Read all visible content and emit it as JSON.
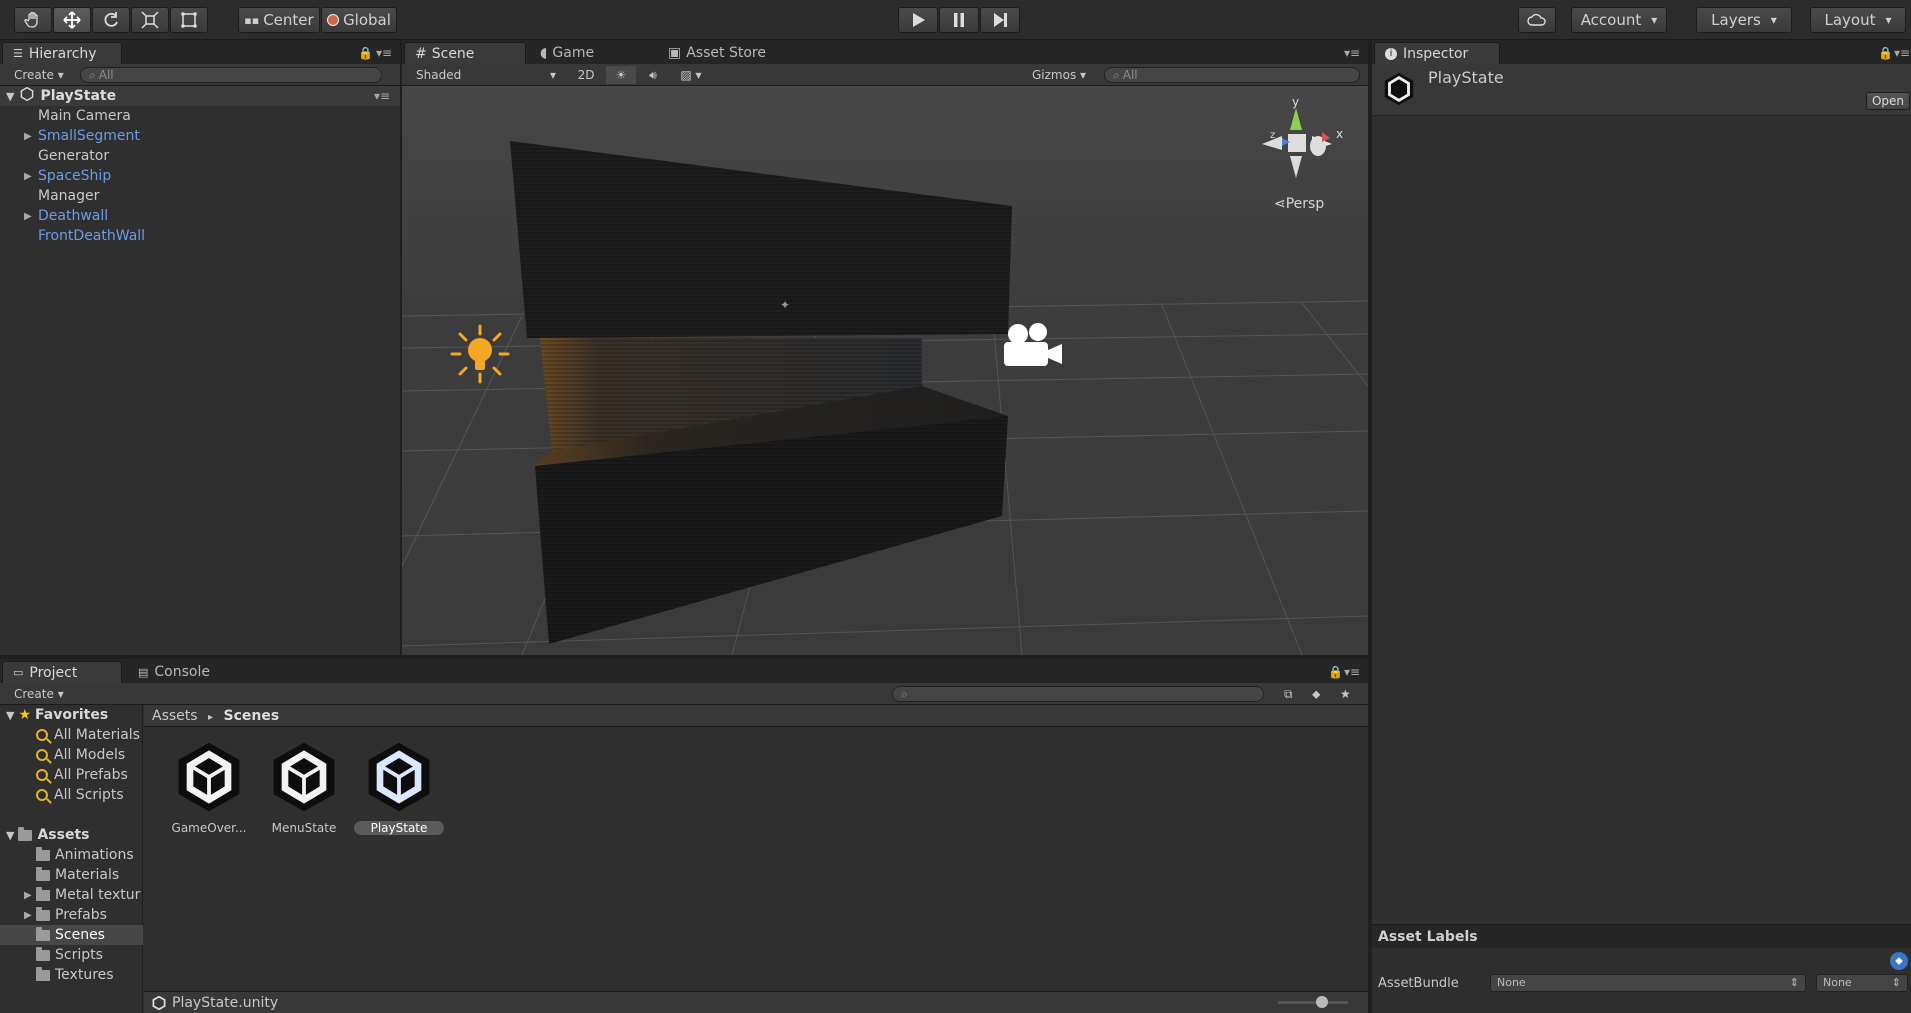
{
  "toolbar": {
    "tools": [
      "hand-icon",
      "move-icon",
      "rotate-icon",
      "scale-icon",
      "rect-icon"
    ],
    "pivot_label": "Center",
    "space_label": "Global",
    "account_label": "Account",
    "layers_label": "Layers",
    "layout_label": "Layout"
  },
  "hierarchy": {
    "tab": "Hierarchy",
    "create_label": "Create",
    "search_placeholder": "All",
    "scene_name": "PlayState",
    "items": [
      {
        "label": "Main Camera",
        "prefab": false,
        "expandable": false
      },
      {
        "label": "SmallSegment",
        "prefab": true,
        "expandable": true
      },
      {
        "label": "Generator",
        "prefab": false,
        "expandable": false
      },
      {
        "label": "SpaceShip",
        "prefab": true,
        "expandable": true
      },
      {
        "label": "Manager",
        "prefab": false,
        "expandable": false
      },
      {
        "label": "Deathwall",
        "prefab": true,
        "expandable": true
      },
      {
        "label": "FrontDeathWall",
        "prefab": true,
        "expandable": false
      }
    ]
  },
  "scene": {
    "tabs": [
      "Scene",
      "Game",
      "Asset Store"
    ],
    "shading_label": "Shaded",
    "mode_2d_label": "2D",
    "gizmos_label": "Gizmos",
    "search_placeholder": "All",
    "persp_label": "Persp",
    "axis_y": "y",
    "axis_x": "x",
    "axis_z": "z"
  },
  "inspector": {
    "tab": "Inspector",
    "asset_name": "PlayState",
    "open_label": "Open",
    "asset_labels_title": "Asset Labels",
    "assetbundle_label": "AssetBundle",
    "assetbundle_value": "None",
    "variant_value": "None"
  },
  "project": {
    "tabs": [
      "Project",
      "Console"
    ],
    "create_label": "Create",
    "favorites_label": "Favorites",
    "favorites": [
      "All Materials",
      "All Models",
      "All Prefabs",
      "All Scripts"
    ],
    "assets_label": "Assets",
    "folders": [
      {
        "label": "Animations",
        "expandable": false,
        "selected": false
      },
      {
        "label": "Materials",
        "expandable": false,
        "selected": false
      },
      {
        "label": "Metal textur",
        "expandable": true,
        "selected": false
      },
      {
        "label": "Prefabs",
        "expandable": true,
        "selected": false
      },
      {
        "label": "Scenes",
        "expandable": false,
        "selected": true
      },
      {
        "label": "Scripts",
        "expandable": false,
        "selected": false
      },
      {
        "label": "Textures",
        "expandable": false,
        "selected": false
      }
    ],
    "breadcrumb_root": "Assets",
    "breadcrumb_current": "Scenes",
    "assets": [
      {
        "label": "GameOver...",
        "selected": false
      },
      {
        "label": "MenuState",
        "selected": false
      },
      {
        "label": "PlayState",
        "selected": true
      }
    ],
    "footer_path": "PlayState.unity"
  },
  "colors": {
    "prefab": "#6b9ce6",
    "selection": "#3d5f8f",
    "sun": "#f5a623"
  }
}
